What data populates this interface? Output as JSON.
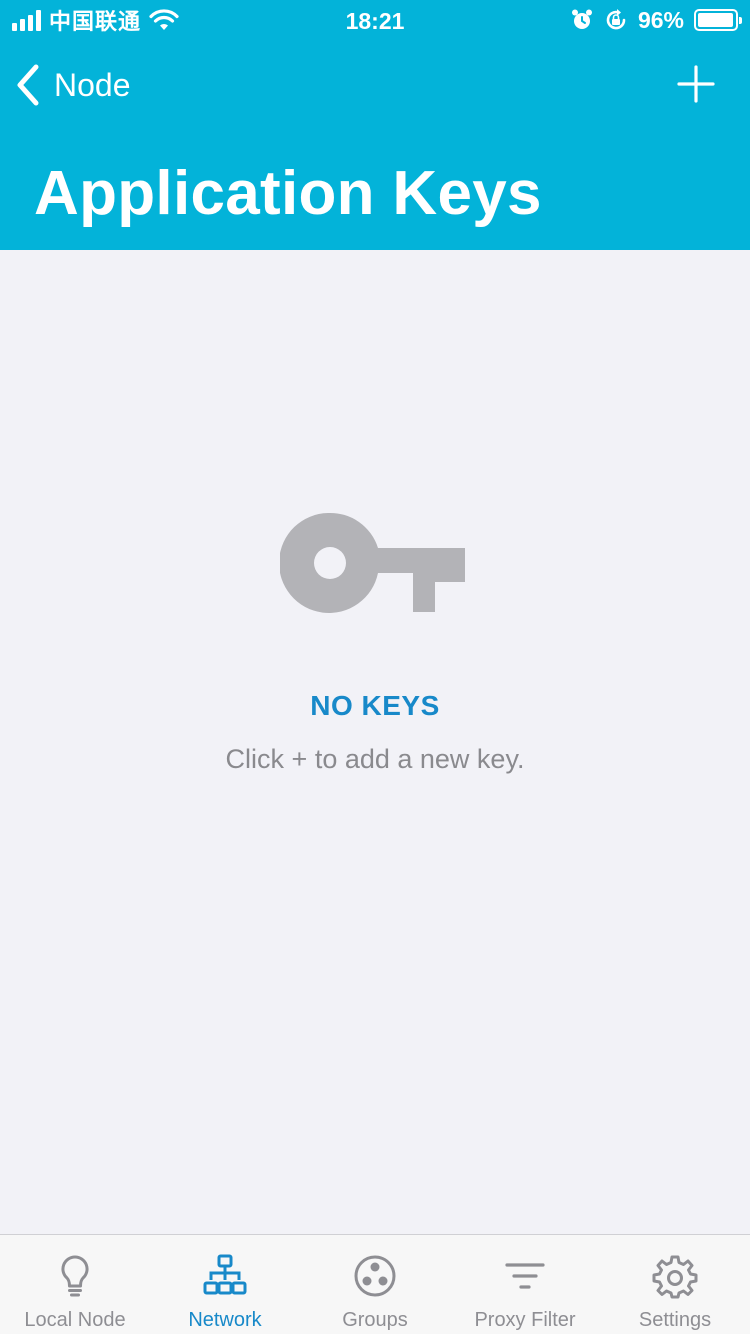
{
  "status_bar": {
    "carrier": "中国联通",
    "time": "18:21",
    "battery": "96%",
    "battery_level": 0.96
  },
  "nav": {
    "back_label": "Node",
    "title": "Application Keys"
  },
  "empty_state": {
    "title": "NO KEYS",
    "subtitle": "Click + to add a new key."
  },
  "tabs": [
    {
      "label": "Local Node",
      "icon": "lightbulb-icon",
      "active": false
    },
    {
      "label": "Network",
      "icon": "network-icon",
      "active": true
    },
    {
      "label": "Groups",
      "icon": "groups-icon",
      "active": false
    },
    {
      "label": "Proxy Filter",
      "icon": "filter-icon",
      "active": false
    },
    {
      "label": "Settings",
      "icon": "gear-icon",
      "active": false
    }
  ],
  "colors": {
    "header": "#03b3d9",
    "accent": "#1889c9",
    "inactive": "#8e8e93",
    "background": "#f2f2f7",
    "key_icon": "#b3b3b7"
  }
}
